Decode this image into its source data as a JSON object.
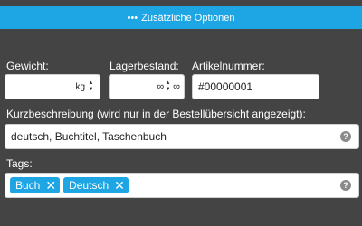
{
  "options_bar": {
    "dots": "•••",
    "label": "Zusätzliche Optionen"
  },
  "weight": {
    "label": "Gewicht:",
    "value": "",
    "unit": "kg"
  },
  "stock": {
    "label": "Lagerbestand:",
    "value": "∞",
    "unit": "∞"
  },
  "article_number": {
    "label": "Artikelnummer:",
    "value": "#00000001"
  },
  "short_description": {
    "label": "Kurzbeschreibung (wird nur in der Bestellübersicht angezeigt):",
    "value": "deutsch, Buchtitel, Taschenbuch",
    "help": "?"
  },
  "tags": {
    "label": "Tags:",
    "items": [
      {
        "label": "Buch",
        "remove": "✕"
      },
      {
        "label": "Deutsch",
        "remove": "✕"
      }
    ],
    "help": "?"
  },
  "spinner": {
    "up": "▲",
    "down": "▼"
  },
  "colors": {
    "accent": "#1ea5e3",
    "background": "#444444",
    "help_icon": "#8a8a8a"
  }
}
